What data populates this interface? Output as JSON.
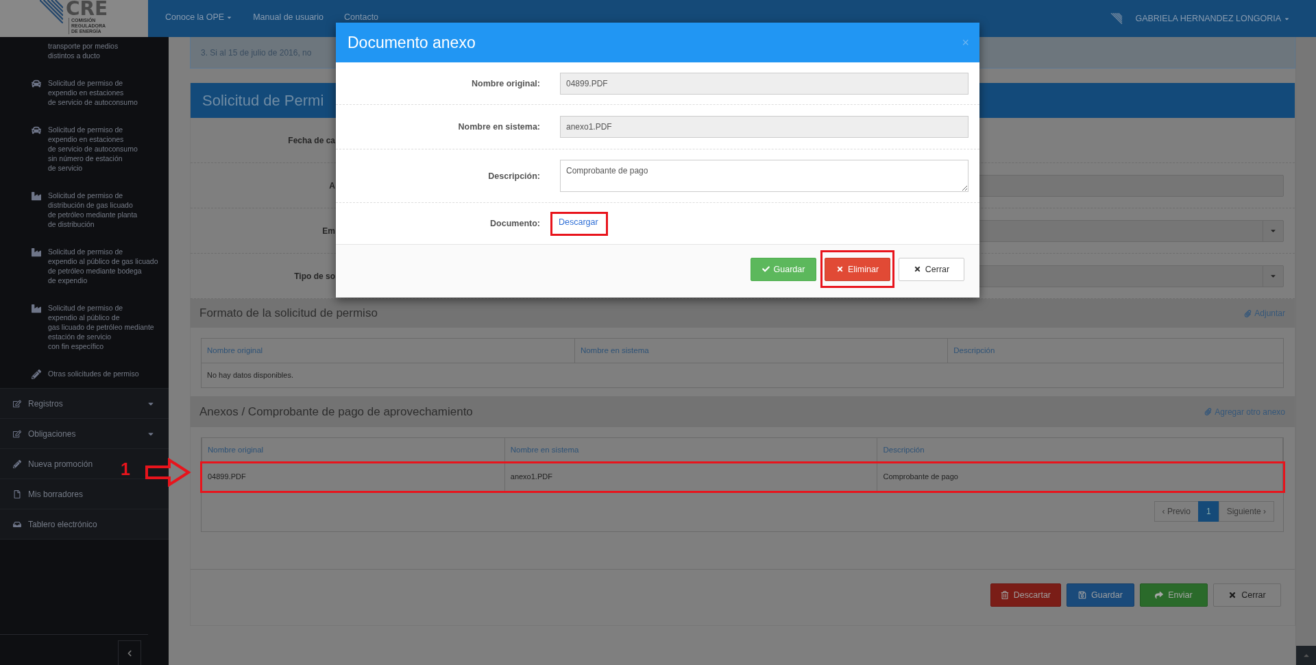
{
  "header": {
    "logo": {
      "mark": "CRE",
      "lines": [
        "COMISIÓN",
        "REGULADORA",
        "DE ENERGÍA"
      ]
    },
    "nav": [
      {
        "label": "Conoce la OPE",
        "dropdown": true
      },
      {
        "label": "Manual de usuario",
        "dropdown": false
      },
      {
        "label": "Contacto",
        "dropdown": false
      }
    ],
    "user": {
      "name": "GABRIELA HERNANDEZ LONGORIA",
      "dropdown": true
    }
  },
  "sidebar": {
    "submenu": [
      {
        "kind": "none",
        "text": "transporte por medios\ndistintos a ducto"
      },
      {
        "kind": "car",
        "text": "Solicitud de permiso de\nexpendio en estaciones\nde servicio de autoconsumo"
      },
      {
        "kind": "car",
        "text": "Solicitud de permiso de\nexpendio en estaciones\nde servicio de autoconsumo\nsin número de estación\nde servicio"
      },
      {
        "kind": "factory",
        "text": "Solicitud de permiso de\ndistribución de gas licuado\nde petróleo mediante planta\nde distribución"
      },
      {
        "kind": "factory",
        "text": "Solicitud de permiso de\nexpendio al público de gas licuado\nde petróleo mediante bodega\nde expendio"
      },
      {
        "kind": "factory",
        "text": "Solicitud de permiso de\nexpendio al público de\ngas licuado de petróleo mediante\nestación de servicio\ncon fin específico"
      },
      {
        "kind": "pencil",
        "text": "Otras solicitudes de permiso"
      }
    ],
    "menu": [
      {
        "kind": "edit",
        "label": "Registros",
        "expandable": true
      },
      {
        "kind": "edit",
        "label": "Obligaciones",
        "expandable": true
      },
      {
        "kind": "pencil",
        "label": "Nueva promoción",
        "expandable": false
      },
      {
        "kind": "file",
        "label": "Mis borradores",
        "expandable": false
      },
      {
        "kind": "inbox",
        "label": "Tablero electrónico",
        "expandable": false
      }
    ]
  },
  "alert": "3. Si al 15 de julio de 2016, no",
  "form": {
    "title": "Solicitud de Permi",
    "rows": [
      {
        "label": "Fecha de ca",
        "kind": "none"
      },
      {
        "label": "A",
        "kind": "input"
      },
      {
        "label": "Em",
        "kind": "select"
      },
      {
        "label": "Tipo de so",
        "kind": "select"
      }
    ]
  },
  "sections": [
    {
      "title": "Formato de la solicitud de permiso",
      "action": "Adjuntar",
      "columns": [
        "Nombre original",
        "Nombre en sistema",
        "Descripción"
      ],
      "empty": "No hay datos disponibles."
    },
    {
      "title": "Anexos / Comprobante de pago de aprovechamiento",
      "action": "Agregar otro anexo",
      "columns": [
        "Nombre original",
        "Nombre en sistema",
        "Descripción"
      ],
      "rows": [
        {
          "cells": [
            "04899.PDF",
            "anexo1.PDF",
            "Comprobante de pago"
          ],
          "highlighted": true
        }
      ],
      "pagination": {
        "prev": "‹ Previo",
        "pages": [
          {
            "label": "1",
            "selected": true
          }
        ],
        "next": "Siguiente ›"
      }
    }
  ],
  "actions": [
    {
      "label": "Descartar",
      "kind": "danger"
    },
    {
      "label": "Guardar",
      "kind": "primary"
    },
    {
      "label": "Enviar",
      "kind": "success"
    },
    {
      "label": "Cerrar",
      "kind": "default"
    }
  ],
  "annotation": {
    "step": "1"
  },
  "modal": {
    "title": "Documento anexo",
    "close": "×",
    "fields": [
      {
        "label": "Nombre original:",
        "kind": "readonly",
        "value": "04899.PDF"
      },
      {
        "label": "Nombre en sistema:",
        "kind": "readonly",
        "value": "anexo1.PDF"
      },
      {
        "label": "Descripción:",
        "kind": "textarea",
        "value": "Comprobante de pago"
      },
      {
        "label": "Documento:",
        "kind": "link",
        "value": "Descargar",
        "highlighted": true
      }
    ],
    "buttons": [
      {
        "label": "Guardar",
        "kind": "success",
        "highlighted": false
      },
      {
        "label": "Eliminar",
        "kind": "danger",
        "highlighted": true
      },
      {
        "label": "Cerrar",
        "kind": "default",
        "highlighted": false
      }
    ]
  }
}
